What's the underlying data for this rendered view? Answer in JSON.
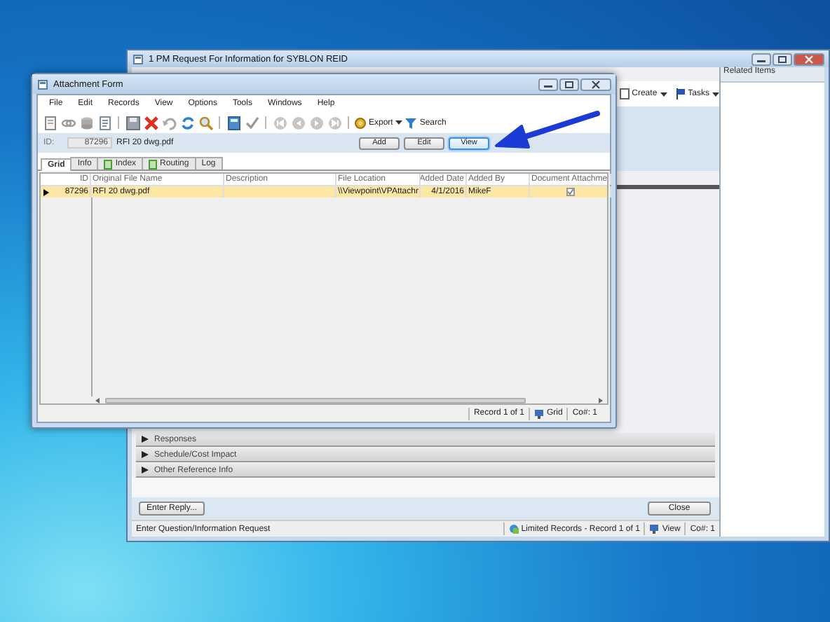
{
  "background_window": {
    "title": "1 PM Request For Information for SYBLON REID",
    "toolbar": [
      {
        "label": "Create"
      },
      {
        "label": "Tasks"
      }
    ],
    "related_items": {
      "title": "Related Items"
    },
    "sections": [
      {
        "label": "Responses",
        "expanded": false
      },
      {
        "label": "Schedule/Cost Impact",
        "expanded": false
      },
      {
        "label": "Other Reference Info",
        "expanded": false
      }
    ],
    "buttons": [
      {
        "label": "Enter Reply..."
      },
      {
        "label": "Close"
      }
    ],
    "status_bar": {
      "message": "Enter Question/Information Request",
      "records": "Limited Records - Record 1 of 1",
      "view": "View",
      "company": "Co#: 1"
    }
  },
  "attachment_form": {
    "title": "Attachment Form",
    "menu": [
      "File",
      "Edit",
      "Records",
      "View",
      "Options",
      "Tools",
      "Windows",
      "Help"
    ],
    "toolbar": [
      {
        "label": "Export"
      },
      {
        "label": "Search"
      }
    ],
    "id_field": {
      "label": "ID:",
      "value": "87296"
    },
    "file_name": "RFI 20 dwg.pdf",
    "buttons": [
      {
        "label": "Add",
        "selected": false
      },
      {
        "label": "Edit",
        "selected": false
      },
      {
        "label": "View",
        "selected": true
      }
    ],
    "tabs": [
      {
        "label": "Grid",
        "selected": true
      },
      {
        "label": "Info",
        "selected": false
      },
      {
        "label": "Index",
        "selected": false
      },
      {
        "label": "Routing",
        "selected": false
      },
      {
        "label": "Log",
        "selected": false
      }
    ],
    "table": {
      "columns": [
        "ID",
        "Original File Name",
        "Description",
        "File Location",
        "Added Date",
        "Added By",
        "Document Attachme"
      ],
      "rows": [
        {
          "id": "87296",
          "original_file_name": "RFI 20 dwg.pdf",
          "file_location": "\\\\Viewpoint\\VPAttachr",
          "added_date": "4/1/2016",
          "added_by": "MikeF",
          "document_attachment": true,
          "selected": true
        }
      ]
    },
    "status_bar": {
      "record": "Record 1 of 1",
      "view": "Grid",
      "company": "Co#: 1"
    }
  }
}
